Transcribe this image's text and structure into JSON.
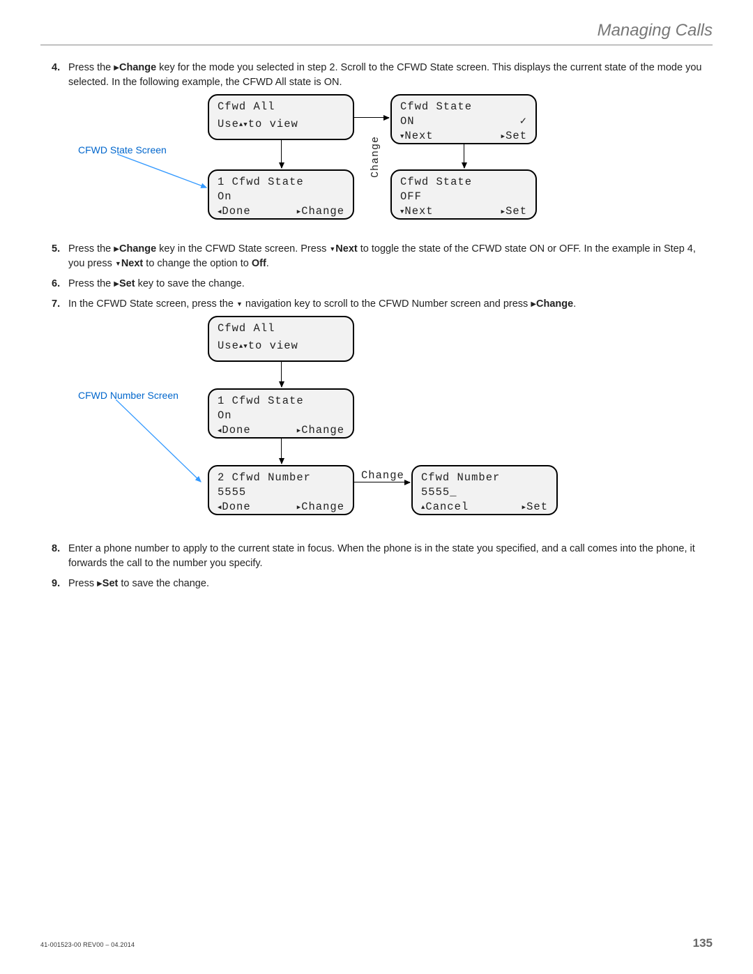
{
  "header": "Managing Calls",
  "steps": {
    "s4": {
      "num": "4.",
      "pre": "Press the ",
      "key": "Change",
      "post": " key for the mode you selected in step 2. Scroll to the CFWD State screen. This displays the current state of the mode you selected. In the following example, the CFWD All state is ON."
    },
    "s5": {
      "num": "5.",
      "t1": "Press the ",
      "k1": "Change",
      "t2": " key in the CFWD State screen. Press ",
      "k2": "Next",
      "t3": " to toggle the state of the CFWD state ON or OFF. In the example in Step 4, you press ",
      "k3": "Next",
      "t4": " to change the option to ",
      "k4": "Off",
      "t5": "."
    },
    "s6": {
      "num": "6.",
      "t1": "Press the ",
      "k1": "Set",
      "t2": " key to save the change."
    },
    "s7": {
      "num": "7.",
      "t1": "In the CFWD State screen, press the ",
      "t2": " navigation key to scroll to the CFWD Number screen and press ",
      "k1": "Change",
      "t3": "."
    },
    "s8": {
      "num": "8.",
      "t1": "Enter a phone number to apply to the current state in focus. When the phone is in the state you specified, and a call comes into the phone, it forwards the call to the number you specify."
    },
    "s9": {
      "num": "9.",
      "t1": "Press ",
      "k1": "Set",
      "t2": " to save the change."
    }
  },
  "callouts": {
    "state": "CFWD State Screen",
    "number": "CFWD Number Screen"
  },
  "labels": {
    "change": "Change"
  },
  "d1": {
    "b1": {
      "l1": "Cfwd All",
      "l2a": "Use",
      "l2b": "to view"
    },
    "b2": {
      "l1": "1 Cfwd State",
      "l2": "On",
      "left": "Done",
      "right": "Change"
    },
    "b3": {
      "l1": "Cfwd State",
      "l2": "ON",
      "left": "Next",
      "right": "Set"
    },
    "b4": {
      "l1": "Cfwd State",
      "l2": "OFF",
      "left": "Next",
      "right": "Set"
    }
  },
  "d2": {
    "b1": {
      "l1": "Cfwd All",
      "l2a": "Use",
      "l2b": "to view"
    },
    "b2": {
      "l1": "1 Cfwd State",
      "l2": "On",
      "left": "Done",
      "right": "Change"
    },
    "b3": {
      "l1": "2 Cfwd Number",
      "l2": "5555",
      "left": "Done",
      "right": "Change"
    },
    "b4": {
      "l1": "Cfwd Number",
      "l2": "5555_",
      "left": "Cancel",
      "right": "Set"
    }
  },
  "footer": {
    "docrev": "41-001523-00 REV00 – 04.2014",
    "page": "135"
  }
}
